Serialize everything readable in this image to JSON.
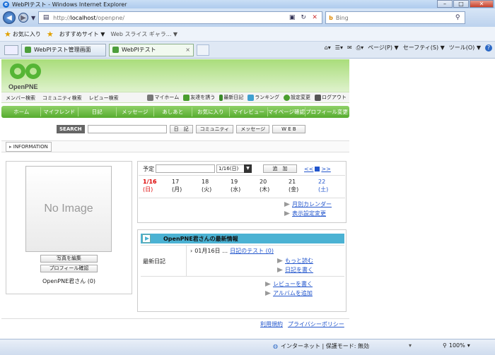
{
  "browser": {
    "title": "WebPIテスト - Windows Internet Explorer",
    "address": {
      "prefix": "http://",
      "host": "localhost",
      "path": "/openpne/"
    },
    "search_placeholder": "Bing",
    "favorites": {
      "label": "お気に入り",
      "suggested": "おすすめサイト ▼",
      "webslice": "Web スライス ギャラ... ▼"
    },
    "tabs": [
      {
        "label": "WebPIテスト管理画面"
      },
      {
        "label": "WebPIテスト",
        "close": "×"
      }
    ],
    "command_bar": {
      "page": "ページ(P) ▼",
      "safety": "セーフティ(S) ▼",
      "tools": "ツール(O) ▼",
      "help": "?"
    },
    "status": {
      "zone": "インターネット | 保護モード: 無効",
      "zoom": "100%"
    }
  },
  "site": {
    "logo_text": "OpenPNE",
    "submenu_left": [
      "メンバー検索",
      "コミュニティ検索",
      "レビュー検索"
    ],
    "submenu_right": [
      "マイホーム",
      "友達を誘う",
      "最新日記",
      "ランキング",
      "設定変更",
      "ログアウト"
    ],
    "global_nav": [
      "ホーム",
      "マイフレンド",
      "日記",
      "メッセージ",
      "あしあと",
      "お気に入り",
      "マイレビュー",
      "マイページ確認",
      "プロフィール変更"
    ],
    "search": {
      "label": "SEARCH",
      "buttons": [
        "日　記",
        "コミュニティ",
        "メッセージ",
        "W E B"
      ]
    },
    "info_tab": "INFORMATION",
    "profile": {
      "no_image": "No Image",
      "edit_photo": "写真を編集",
      "check_profile": "プロフィール確認",
      "nickname": "OpenPNE君さん (0)"
    },
    "calendar": {
      "label": "予定",
      "date_select": "1/16(日)",
      "add_button": "追　加",
      "nav_prev": "<<",
      "nav_next": ">>",
      "days": [
        {
          "date": "1/16",
          "dow": "(日)"
        },
        {
          "date": "17",
          "dow": "(月)"
        },
        {
          "date": "18",
          "dow": "(火)"
        },
        {
          "date": "19",
          "dow": "(水)"
        },
        {
          "date": "20",
          "dow": "(木)"
        },
        {
          "date": "21",
          "dow": "(金)"
        },
        {
          "date": "22",
          "dow": "(土)"
        }
      ],
      "links": [
        "月別カレンダー",
        "表示設定変更"
      ]
    },
    "latest": {
      "title": "OpenPNE君さんの最新情報",
      "row_label": "最新日記",
      "entry_date": "01月16日 …",
      "entry_title": "日記のテスト (0)",
      "more": "もっと読む",
      "write": "日記を書く",
      "review": "レビューを書く",
      "album": "アルバムを追加"
    },
    "footer": {
      "terms": "利用規約",
      "privacy": "プライバシーポリシー"
    }
  }
}
